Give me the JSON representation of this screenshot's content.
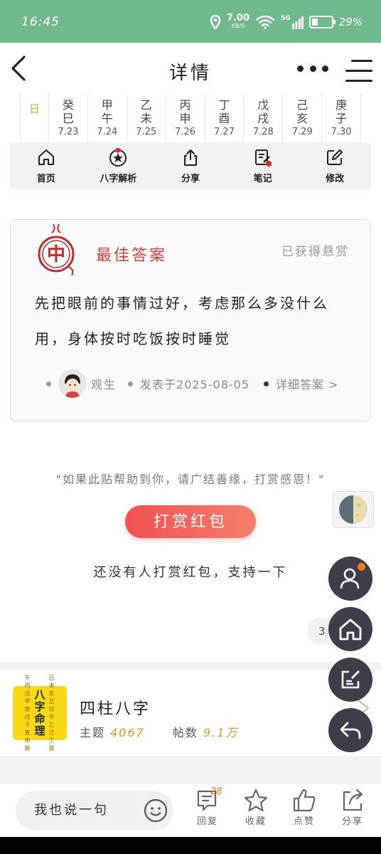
{
  "status_bar": {
    "time": "16:45",
    "speed": "7.00",
    "speed_unit": "KB/S",
    "network": "5G",
    "battery": "29%"
  },
  "nav": {
    "title": "详情",
    "back_icon": "back-arrow-icon",
    "more_icon": "more-dots-icon",
    "menu_icon": "menu-icon"
  },
  "calendar": {
    "label": "日",
    "days": [
      {
        "gz": "癸巳",
        "date": "7.23"
      },
      {
        "gz": "甲午",
        "date": "7.24"
      },
      {
        "gz": "乙未",
        "date": "7.25"
      },
      {
        "gz": "丙申",
        "date": "7.26"
      },
      {
        "gz": "丁酉",
        "date": "7.27"
      },
      {
        "gz": "戊戌",
        "date": "7.28"
      },
      {
        "gz": "己亥",
        "date": "7.29"
      },
      {
        "gz": "庚子",
        "date": "7.30"
      }
    ]
  },
  "toolbar": {
    "items": [
      {
        "label": "首页",
        "icon": "home-icon"
      },
      {
        "label": "八字解析",
        "icon": "star-icon"
      },
      {
        "label": "分享",
        "icon": "share-icon"
      },
      {
        "label": "笔记",
        "icon": "note-icon"
      },
      {
        "label": "修改",
        "icon": "edit-icon"
      }
    ]
  },
  "answer": {
    "badge_char": "中",
    "heading": "最佳答案",
    "status": "已获得悬赏",
    "text": "先把眼前的事情过好，考虑那么多没什么用，身体按时吃饭按时睡觉",
    "author": "观生",
    "date": "发表于2025-08-05",
    "link": "详细答案 >"
  },
  "reward": {
    "quote": "\"如果此贴帮助到你，请广结善缘，打赏感恩！\"",
    "button": "打赏红包",
    "status": "还没有人打赏红包，支持一下",
    "count": "3"
  },
  "forum": {
    "logo_left": "午丙戊甲庚戌子寅申辰",
    "logo_main": "八字命理",
    "logo_right": "巳未亥丑卯辛乙己丁癸",
    "name": "四柱八字",
    "topics_label": "主题",
    "topics_value": "4067",
    "posts_label": "帖数",
    "posts_value": "9.1万"
  },
  "bottom_bar": {
    "input_placeholder": "我也说一句",
    "reply_label": "回复",
    "reply_count": "28",
    "favorite_label": "收藏",
    "like_label": "点赞",
    "share_label": "分享"
  },
  "colors": {
    "status_bar": "#6fb98c",
    "accent_red": "#d9403a",
    "accent_orange": "#e09a2a",
    "float_button": "#3e3e48"
  }
}
